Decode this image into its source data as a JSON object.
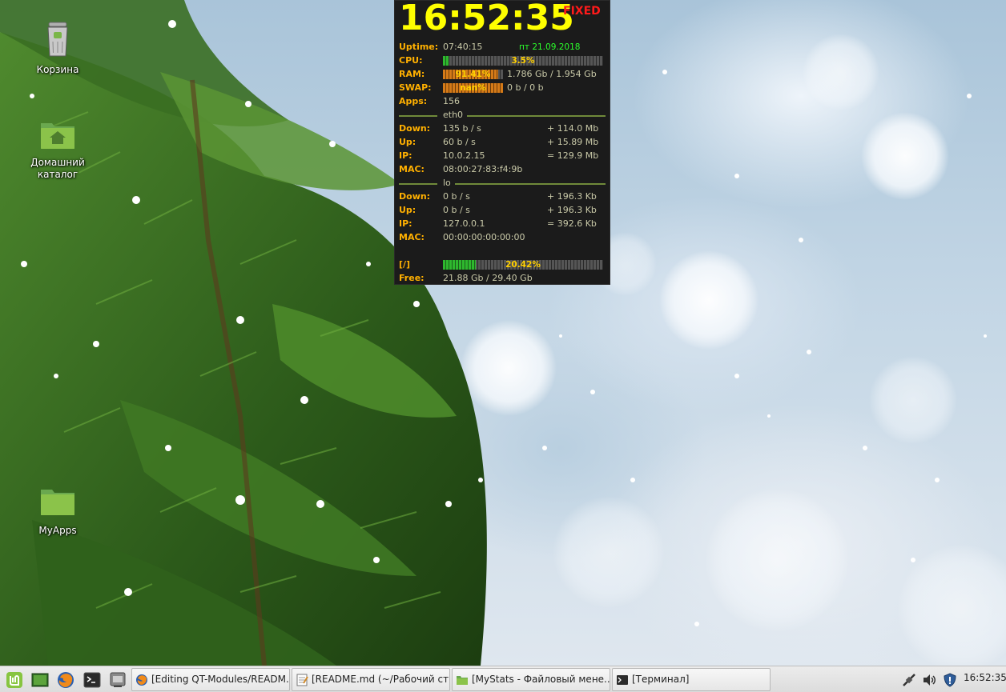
{
  "desktop": {
    "icons": [
      {
        "label": "Корзина",
        "icon": "trash-icon"
      },
      {
        "label": "Домашний каталог",
        "icon": "home-folder-icon"
      },
      {
        "label": "MyApps",
        "icon": "folder-icon"
      }
    ]
  },
  "conky": {
    "clock": "16:52:35",
    "status_flag": "FIXED",
    "uptime_label": "Uptime:",
    "uptime": "07:40:15",
    "date": "пт 21.09.2018",
    "cpu_label": "CPU:",
    "cpu_percent_text": "3.5%",
    "cpu_fraction": 0.035,
    "ram_label": "RAM:",
    "ram_percent_text": "91.41%",
    "ram_fraction": 0.9141,
    "ram_usage": "1.786 Gb / 1.954 Gb",
    "swap_label": "SWAP:",
    "swap_percent_text": "nan%",
    "swap_fraction": 1.0,
    "swap_usage": "0 b / 0 b",
    "apps_label": "Apps:",
    "apps": "156",
    "eth0": {
      "name": "eth0",
      "down_label": "Down:",
      "down": "135 b / s",
      "down_total": "+ 114.0 Mb",
      "up_label": "Up:",
      "up": "60 b / s",
      "up_total": "+ 15.89 Mb",
      "ip_label": "IP:",
      "ip": "10.0.2.15",
      "total": "= 129.9 Mb",
      "mac_label": "MAC:",
      "mac": "08:00:27:83:f4:9b"
    },
    "lo": {
      "name": "lo",
      "down_label": "Down:",
      "down": "0 b / s",
      "down_total": "+ 196.3 Kb",
      "up_label": "Up:",
      "up": "0 b / s",
      "up_total": "+ 196.3 Kb",
      "ip_label": "IP:",
      "ip": "127.0.0.1",
      "total": "= 392.6 Kb",
      "mac_label": "MAC:",
      "mac": "00:00:00:00:00:00"
    },
    "disk": {
      "mount_label": "[/]",
      "percent_text": "20.42%",
      "fraction": 0.2042,
      "free_label": "Free:",
      "free": "21.88 Gb / 29.40 Gb"
    },
    "colors": {
      "clock": "#ffff00",
      "flag": "#ff1a1a",
      "label": "#ffb000",
      "date": "#2bff2b",
      "bar_ok": "#2eb82e",
      "bar_hot": "#d47a18"
    }
  },
  "taskbar": {
    "launchers": [
      {
        "icon": "mint-menu-icon"
      },
      {
        "icon": "show-desktop-icon"
      },
      {
        "icon": "firefox-icon"
      },
      {
        "icon": "terminal-icon"
      },
      {
        "icon": "window-icon"
      }
    ],
    "tasks": [
      {
        "label": "[Editing QT-Modules/READM...",
        "icon": "browser-task-icon"
      },
      {
        "label": "[README.md (~/Рабочий ст...",
        "icon": "text-editor-task-icon"
      },
      {
        "label": "[MyStats - Файловый мене...",
        "icon": "file-manager-task-icon"
      },
      {
        "label": "[Терминал]",
        "icon": "terminal-task-icon"
      }
    ],
    "tray": {
      "icons": [
        "network-icon",
        "volume-icon",
        "shield-icon"
      ],
      "clock": "16:52:35"
    }
  }
}
